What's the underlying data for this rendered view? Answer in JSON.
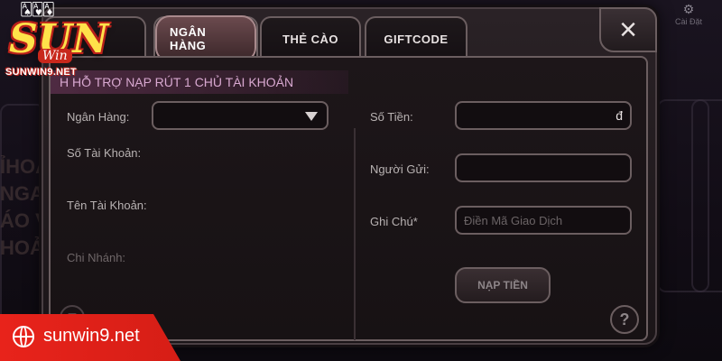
{
  "brand": {
    "logo_text": "SUN",
    "logo_sub": "Win",
    "domain": "SUNWIN9.NET",
    "banner_text": "sunwin9.net"
  },
  "background": {
    "settings_label": "Cài Đặt",
    "text_lines": [
      "ỈHOA",
      "NGAY",
      "ÁO V",
      "HOẢ"
    ]
  },
  "tabs": [
    {
      "label": "",
      "active": false
    },
    {
      "label": "NGÂN HÀNG",
      "active": true
    },
    {
      "label": "THẺ CÀO",
      "active": false
    },
    {
      "label": "GIFTCODE",
      "active": false
    }
  ],
  "notice": "H HỖ TRỢ NẠP RÚT 1 CHỦ TÀI KHOẢN",
  "left_form": {
    "bank_label": "Ngân Hàng:",
    "bank_value": "",
    "account_number_label": "Số Tài Khoản:",
    "account_name_label": "Tên Tài Khoản:",
    "branch_label": "Chi Nhánh:"
  },
  "right_form": {
    "amount_label": "Số Tiền:",
    "amount_value": "",
    "currency_symbol": "đ",
    "sender_label": "Người Gửi:",
    "sender_value": "",
    "note_label": "Ghi Chú*",
    "note_placeholder": "Điền Mã Giao Dịch",
    "submit_label": "NẠP TIỀN"
  },
  "icons": {
    "close": "×",
    "help": "?"
  },
  "colors": {
    "banner_red": "#e8231b",
    "logo_yellow": "#ffe24a",
    "notice_pink": "#d8a8d0"
  }
}
